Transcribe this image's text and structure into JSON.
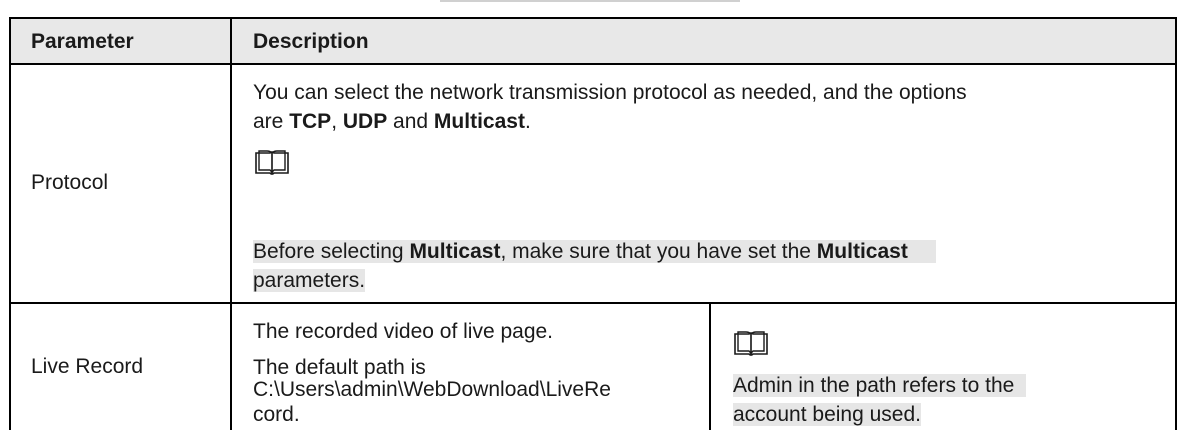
{
  "table": {
    "headers": {
      "parameter": "Parameter",
      "description": "Description"
    },
    "rows": [
      {
        "name": "Protocol",
        "desc_parts": {
          "line1": "You can select the network transmission protocol as needed, and the options",
          "line2_pre": "are ",
          "tcp": "TCP",
          "sep1": ", ",
          "udp": "UDP",
          "sep2": " and ",
          "multicast": "Multicast",
          "end": "."
        },
        "icon": "book-icon",
        "note_parts": {
          "pre": "Before selecting ",
          "multicast1": "Multicast",
          "mid": ", make sure that you have set the ",
          "multicast2": "Multicast",
          "line2": "parameters."
        }
      },
      {
        "name": "Live Record",
        "desc_lines": [
          "The recorded video of live page.",
          "The default path is",
          "C:\\Users\\admin\\WebDownload\\LiveRe",
          "cord."
        ],
        "icon": "book-icon",
        "note_lines": [
          "Admin in the path refers to the",
          "account being used."
        ]
      }
    ]
  },
  "colors": {
    "header_bg": "#e8e8e8",
    "note_highlight": "#e6e6e6",
    "border": "#000000"
  }
}
